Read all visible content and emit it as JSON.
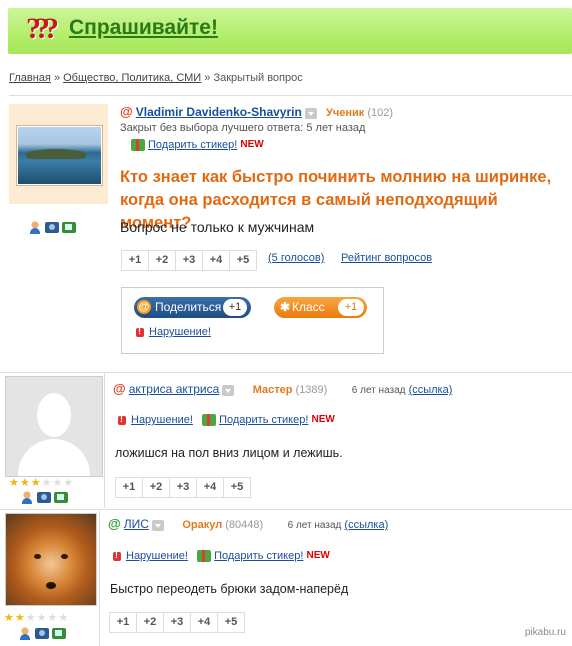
{
  "header": {
    "logo_mark": "???",
    "site_title": "Спрашивайте!"
  },
  "breadcrumb": {
    "home": "Главная",
    "sep1": "»",
    "category": "Общество, Политика, СМИ",
    "sep2": "»",
    "current": "Закрытый вопрос"
  },
  "question": {
    "author": "Vladimir Davidenko-Shavyrin",
    "rank": "Ученик",
    "points": "(102)",
    "status": "Закрыт без выбора лучшего ответа: 5 лет назад",
    "gift_label": "Подарить стикер!",
    "new_badge": "NEW",
    "title": "Кто знает как быстро починить молнию на ширинке, когда она расходится в самый неподходящий момент?",
    "body": "Вопрос не только к мужчинам",
    "votes": [
      "+1",
      "+2",
      "+3",
      "+4",
      "+5"
    ],
    "votes_count": "(5 голосов)",
    "rating_link": "Рейтинг вопросов",
    "share": {
      "share_label": "Поделиться",
      "share_count": "+1",
      "ok_label": "Класс",
      "ok_count": "+1",
      "report": "Нарушение!"
    }
  },
  "answers": [
    {
      "author": "актриса актриса",
      "rank": "Мастер",
      "points": "(1389)",
      "time": "6 лет назад",
      "link": "(ссылка)",
      "report": "Нарушение!",
      "gift_label": "Подарить стикер!",
      "new_badge": "NEW",
      "text": "ложишся на пол вниз лицом и лежишь.",
      "stars": 3,
      "votes": [
        "+1",
        "+2",
        "+3",
        "+4",
        "+5"
      ]
    },
    {
      "author": "ЛИС",
      "rank": "Оракул",
      "points": "(80448)",
      "time": "6 лет назад",
      "link": "(ссылка)",
      "report": "Нарушение!",
      "gift_label": "Подарить стикер!",
      "new_badge": "NEW",
      "text": "Быстро переодеть брюки задом-наперёд",
      "stars": 2,
      "votes": [
        "+1",
        "+2",
        "+3",
        "+4",
        "+5"
      ]
    }
  ],
  "watermark": "pikabu.ru",
  "colors": {
    "header_green": "#b3ee6b",
    "logo_green": "#2a7a19",
    "title_orange": "#e06a12",
    "link_blue": "#1a4e9c",
    "rank_orange": "#e07a1e"
  }
}
